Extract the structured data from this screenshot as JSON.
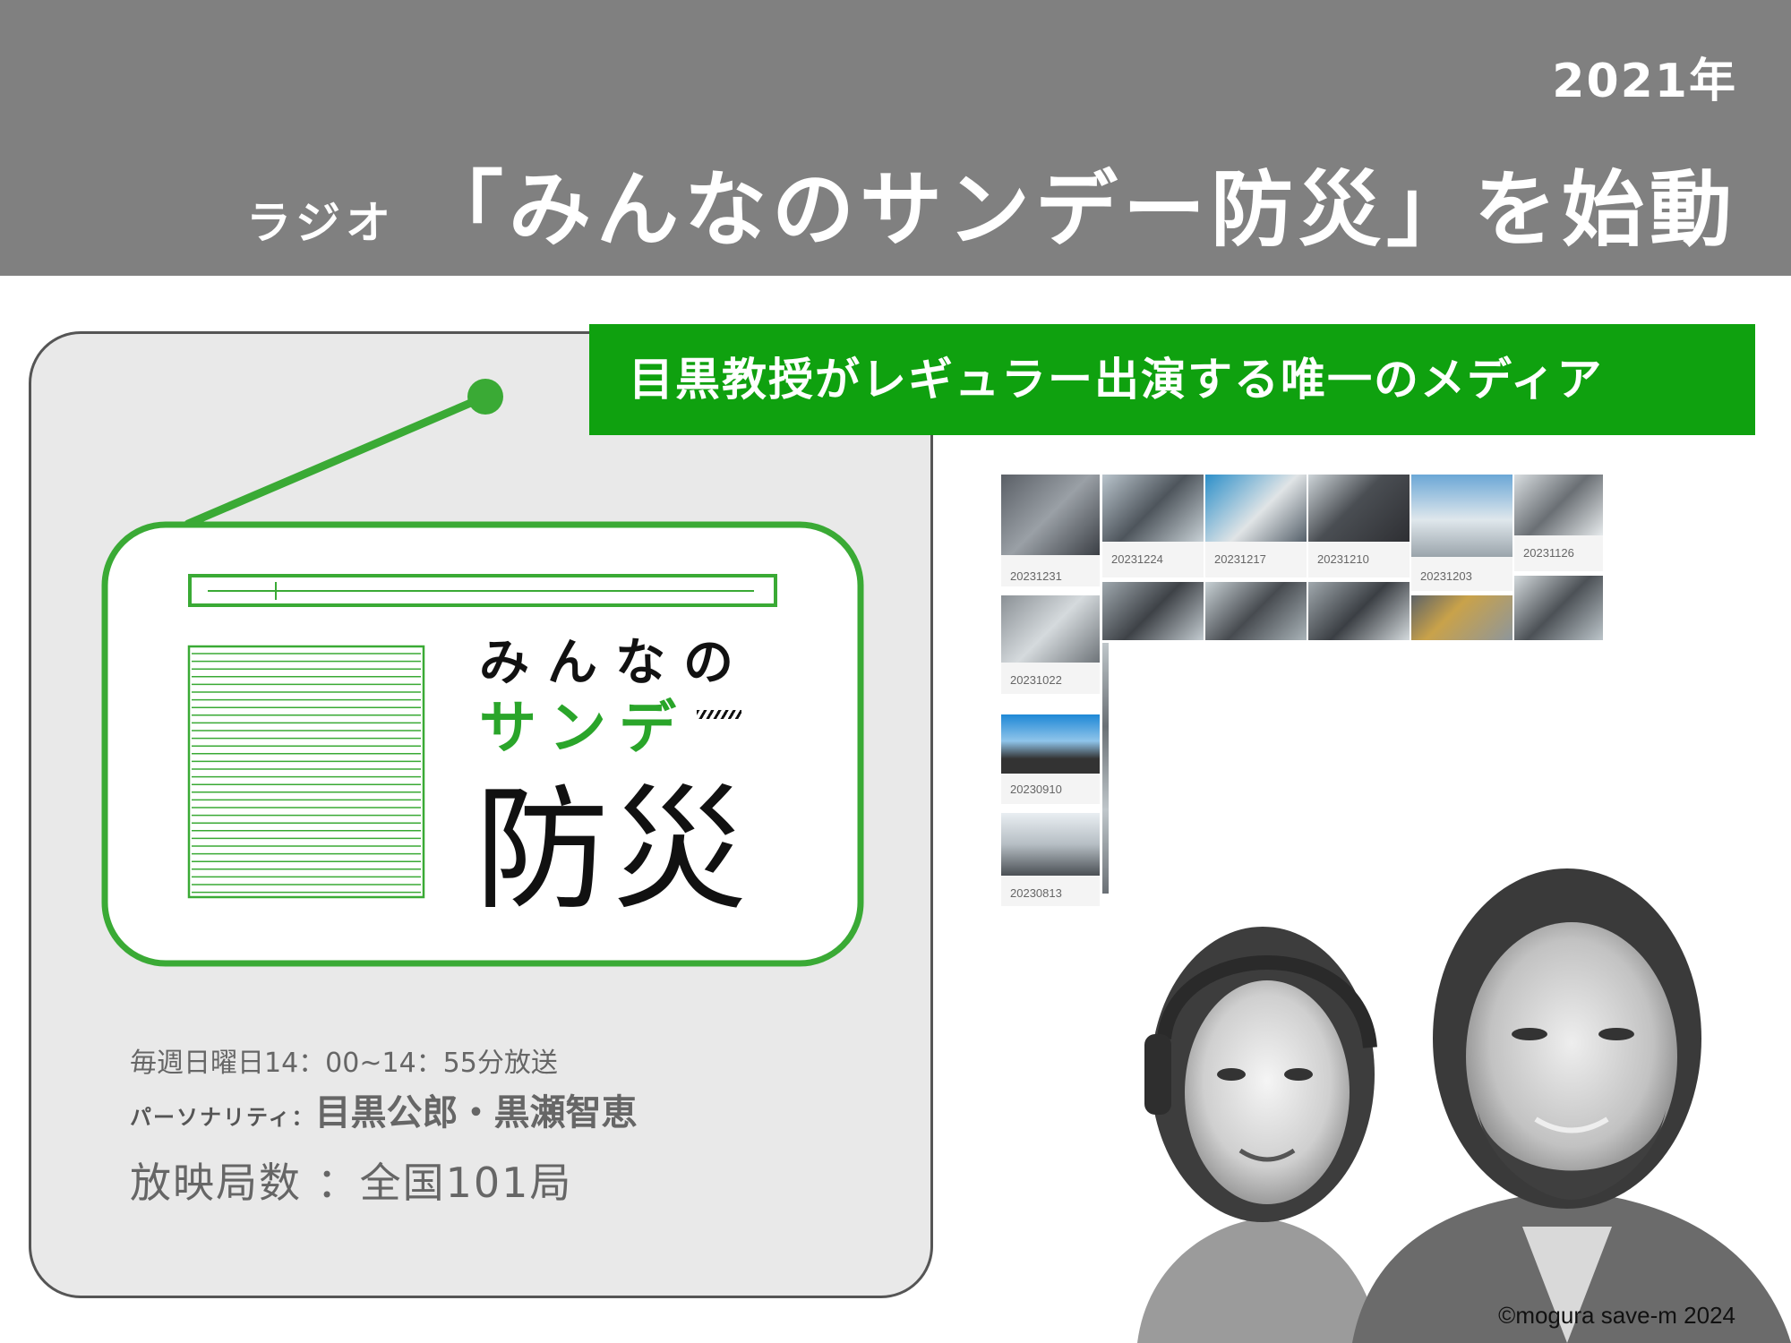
{
  "header": {
    "year": "2021年",
    "title_small": "ラジオ",
    "title_main": "「みんなのサンデー防災」を始動"
  },
  "banner": {
    "text": "目黒教授がレギュラー出演する唯一のメディア"
  },
  "logo": {
    "line1": "みんなの",
    "line2": "サンデ",
    "line3": "防災",
    "icon": "radio-icon",
    "accent_color": "#2aa52a"
  },
  "info": {
    "schedule": "毎週日曜日14：00~14：55分放送",
    "personality_label": "パーソナリティ：",
    "personality_names": "目黒公郎・黒瀬智恵",
    "stations": "放映局数 ：全国101局"
  },
  "thumbnails": [
    {
      "date": "20231231"
    },
    {
      "date": "20231224"
    },
    {
      "date": "20231217"
    },
    {
      "date": "20231210"
    },
    {
      "date": "20231203"
    },
    {
      "date": "20231126"
    },
    {
      "date": "20231022"
    },
    {
      "date": "20230910"
    },
    {
      "date": "20230813"
    }
  ],
  "copyright": "©mogura save-m 2024",
  "colors": {
    "header_bg": "#808080",
    "banner_bg": "#0fa10f",
    "card_bg": "#e9e9e9"
  }
}
